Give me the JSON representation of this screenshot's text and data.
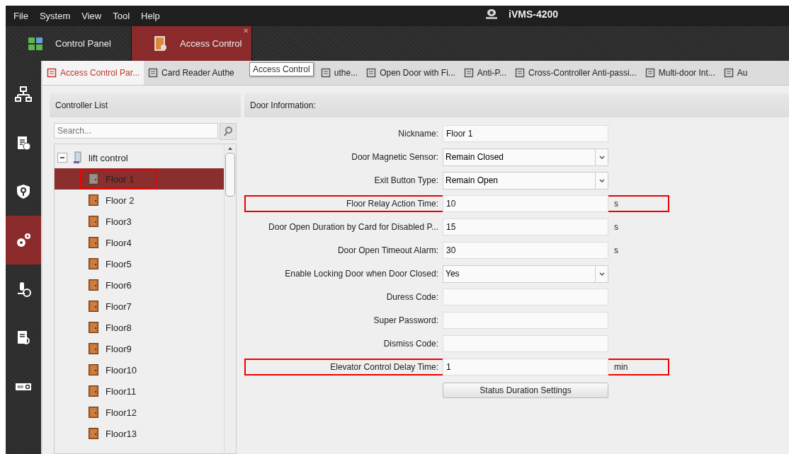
{
  "menu": [
    "File",
    "System",
    "View",
    "Tool",
    "Help"
  ],
  "window": {
    "title": "iVMS-4200"
  },
  "module_tabs": [
    {
      "label": "Control Panel",
      "selected": false
    },
    {
      "label": "Access Control",
      "selected": true,
      "close": "✕"
    }
  ],
  "sidebar": {
    "items": [
      {
        "selected": false
      },
      {
        "selected": false
      },
      {
        "selected": false
      },
      {
        "selected": true
      },
      {
        "selected": false
      },
      {
        "selected": false
      },
      {
        "selected": false
      }
    ]
  },
  "sub_tabs": [
    {
      "label": "Access Control Par...",
      "selected": true
    },
    {
      "label": "Card Reader Authe",
      "selected": false
    },
    {
      "label": "uthe...",
      "selected": false
    },
    {
      "label": "Open Door with Fi...",
      "selected": false
    },
    {
      "label": "Anti-P...",
      "selected": false
    },
    {
      "label": "Cross-Controller Anti-passi...",
      "selected": false
    },
    {
      "label": "Multi-door Int...",
      "selected": false
    },
    {
      "label": "Au",
      "selected": false
    }
  ],
  "tooltip": "Access Control",
  "controller_list": {
    "title": "Controller List",
    "search": {
      "placeholder": "Search..."
    },
    "tree": [
      {
        "label": "lift control",
        "expanded": true,
        "children": [
          {
            "label": "Floor 1",
            "selected": true,
            "highlighted": true
          },
          {
            "label": "Floor 2",
            "selected": false,
            "highlighted": false
          },
          {
            "label": "Floor3",
            "selected": false,
            "highlighted": false
          },
          {
            "label": "Floor4",
            "selected": false,
            "highlighted": false
          },
          {
            "label": "Floor5",
            "selected": false,
            "highlighted": false
          },
          {
            "label": "Floor6",
            "selected": false,
            "highlighted": false
          },
          {
            "label": "Floor7",
            "selected": false,
            "highlighted": false
          },
          {
            "label": "Floor8",
            "selected": false,
            "highlighted": false
          },
          {
            "label": "Floor9",
            "selected": false,
            "highlighted": false
          },
          {
            "label": "Floor10",
            "selected": false,
            "highlighted": false
          },
          {
            "label": "Floor11",
            "selected": false,
            "highlighted": false
          },
          {
            "label": "Floor12",
            "selected": false,
            "highlighted": false
          },
          {
            "label": "Floor13",
            "selected": false,
            "highlighted": false
          }
        ]
      }
    ]
  },
  "door_information": {
    "title": "Door Information:",
    "fields": [
      {
        "kind": "text",
        "label": "Nickname:",
        "value": "Floor 1",
        "highlighted": false
      },
      {
        "kind": "select",
        "label": "Door Magnetic Sensor:",
        "value": "Remain Closed",
        "highlighted": false
      },
      {
        "kind": "select",
        "label": "Exit Button Type:",
        "value": "Remain Open",
        "highlighted": false
      },
      {
        "kind": "text",
        "label": "Floor Relay Action Time:",
        "value": "10",
        "unit": "s",
        "highlighted": true
      },
      {
        "kind": "text",
        "label": "Door Open Duration by Card for Disabled P...",
        "value": "15",
        "unit": "s",
        "highlighted": false
      },
      {
        "kind": "text",
        "label": "Door Open Timeout Alarm:",
        "value": "30",
        "unit": "s",
        "highlighted": false
      },
      {
        "kind": "select",
        "label": "Enable Locking Door when Door Closed:",
        "value": "Yes",
        "highlighted": false
      },
      {
        "kind": "text",
        "label": "Duress Code:",
        "highlighted": false
      },
      {
        "kind": "text",
        "label": "Super Password:",
        "highlighted": false
      },
      {
        "kind": "text",
        "label": "Dismiss Code:",
        "highlighted": false
      },
      {
        "kind": "text",
        "label": "Elevator Control Delay Time:",
        "value": "1",
        "unit": "min",
        "highlighted": true
      }
    ],
    "button": "Status Duration Settings"
  }
}
